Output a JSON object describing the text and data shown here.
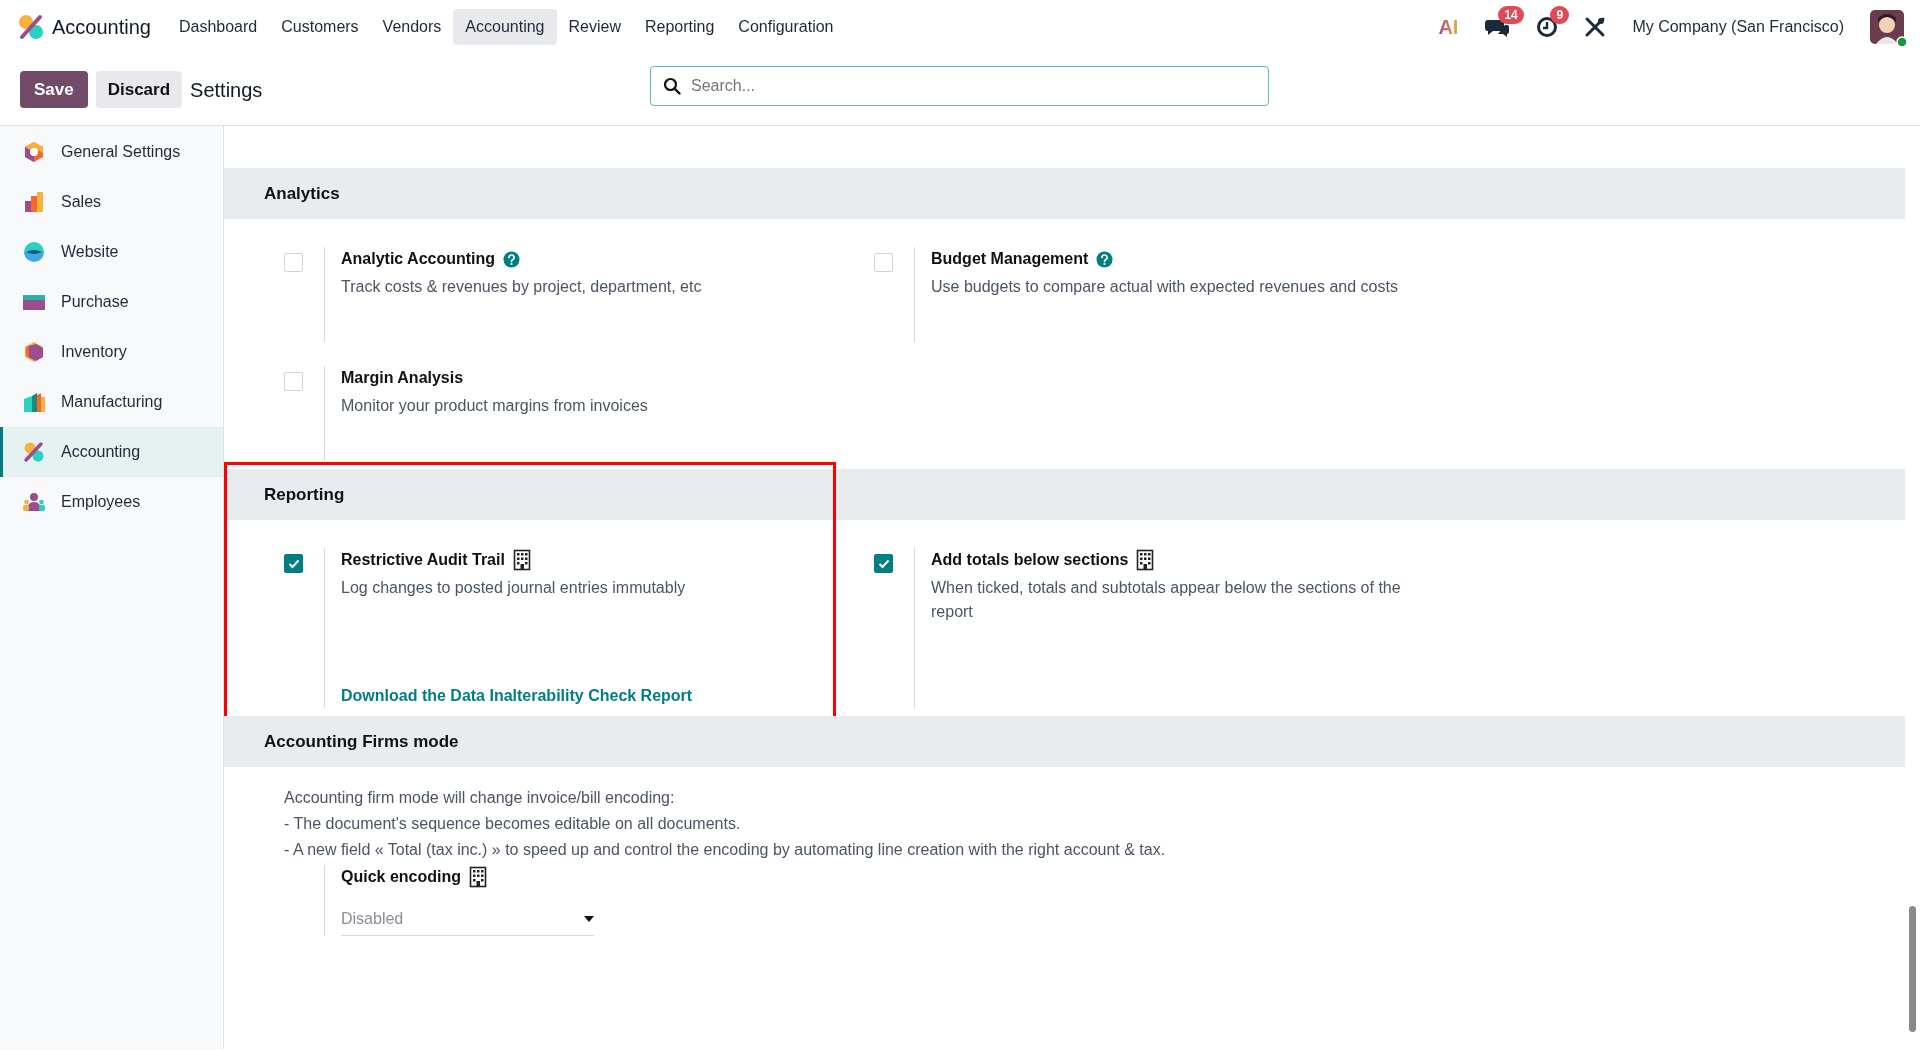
{
  "app": {
    "name": "Accounting"
  },
  "menu": [
    {
      "label": "Dashboard",
      "selected": false
    },
    {
      "label": "Customers",
      "selected": false
    },
    {
      "label": "Vendors",
      "selected": false
    },
    {
      "label": "Accounting",
      "selected": true
    },
    {
      "label": "Review",
      "selected": false
    },
    {
      "label": "Reporting",
      "selected": false
    },
    {
      "label": "Configuration",
      "selected": false
    }
  ],
  "systray": {
    "ai_label": "AI",
    "messages_count": "14",
    "activities_count": "9",
    "company": "My Company (San Francisco)",
    "online": true
  },
  "control_panel": {
    "save": "Save",
    "discard": "Discard",
    "breadcrumb": "Settings",
    "search": {
      "placeholder": "Search..."
    }
  },
  "sidebar": {
    "items": [
      {
        "label": "General Settings",
        "selected": false
      },
      {
        "label": "Sales",
        "selected": false
      },
      {
        "label": "Website",
        "selected": false
      },
      {
        "label": "Purchase",
        "selected": false
      },
      {
        "label": "Inventory",
        "selected": false
      },
      {
        "label": "Manufacturing",
        "selected": false
      },
      {
        "label": "Accounting",
        "selected": true
      },
      {
        "label": "Employees",
        "selected": false
      }
    ]
  },
  "sections": [
    {
      "title": "Analytics",
      "highlighted": false,
      "settings": [
        {
          "kind": "checkbox",
          "title": "Analytic Accounting",
          "help": true,
          "company_specific": false,
          "checked": false,
          "description": "Track costs & revenues by project, department, etc"
        },
        {
          "kind": "checkbox",
          "title": "Budget Management",
          "help": true,
          "company_specific": false,
          "checked": false,
          "description": "Use budgets to compare actual with expected revenues and costs"
        },
        {
          "kind": "checkbox",
          "title": "Margin Analysis",
          "help": false,
          "company_specific": false,
          "checked": false,
          "description": "Monitor your product margins from invoices"
        }
      ]
    },
    {
      "title": "Reporting",
      "highlighted": true,
      "settings": [
        {
          "kind": "checkbox",
          "title": "Restrictive Audit Trail",
          "help": false,
          "company_specific": true,
          "checked": true,
          "description": "Log changes to posted journal entries immutably",
          "link": "Download the Data Inalterability Check Report"
        },
        {
          "kind": "checkbox",
          "title": "Add totals below sections",
          "help": false,
          "company_specific": true,
          "checked": true,
          "description": "When ticked, totals and subtotals appear below the sections of the report"
        }
      ]
    },
    {
      "title": "Accounting Firms mode",
      "highlighted": false,
      "intro_lines": [
        "Accounting firm mode will change invoice/bill encoding:",
        "- The document's sequence becomes editable on all documents.",
        "- A new field « Total (tax inc.) » to speed up and control the encoding by automating line creation with the right account & tax."
      ],
      "settings": [
        {
          "kind": "select",
          "title": "Quick encoding",
          "help": false,
          "company_specific": true,
          "value": "Disabled"
        }
      ]
    }
  ]
}
